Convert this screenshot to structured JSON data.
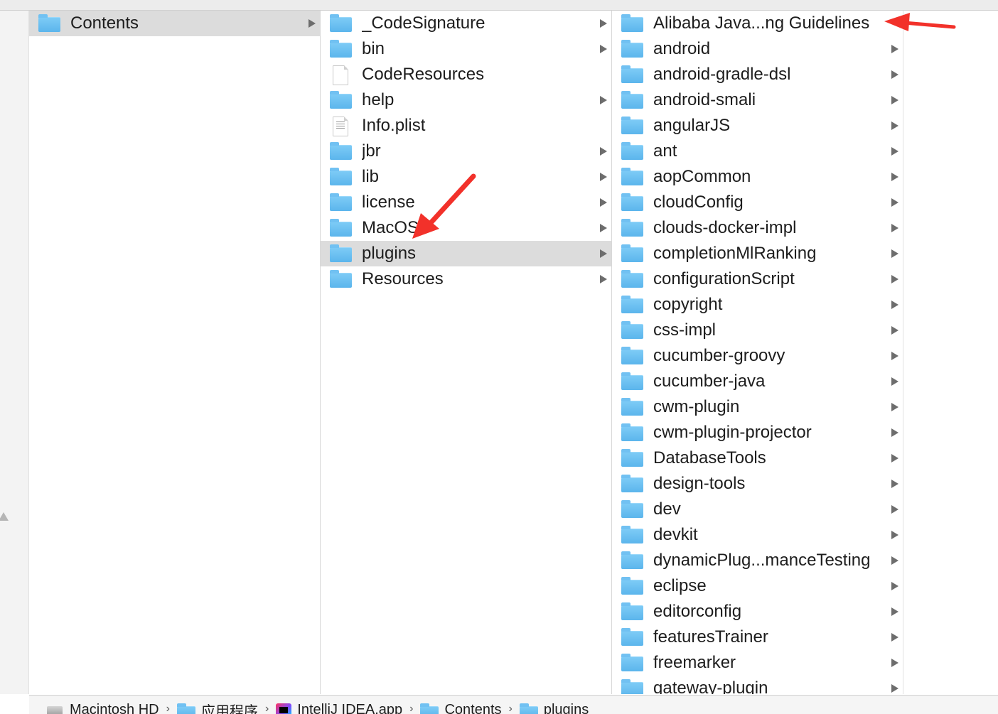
{
  "finder": {
    "columns": [
      {
        "items": [
          {
            "label": "Contents",
            "type": "folder",
            "has_children": true,
            "selected": true
          }
        ]
      },
      {
        "items": [
          {
            "label": "_CodeSignature",
            "type": "folder",
            "has_children": true
          },
          {
            "label": "bin",
            "type": "folder",
            "has_children": true
          },
          {
            "label": "CodeResources",
            "type": "file",
            "has_children": false
          },
          {
            "label": "help",
            "type": "folder",
            "has_children": true
          },
          {
            "label": "Info.plist",
            "type": "plist",
            "has_children": false
          },
          {
            "label": "jbr",
            "type": "folder",
            "has_children": true
          },
          {
            "label": "lib",
            "type": "folder",
            "has_children": true
          },
          {
            "label": "license",
            "type": "folder",
            "has_children": true
          },
          {
            "label": "MacOS",
            "type": "folder",
            "has_children": true
          },
          {
            "label": "plugins",
            "type": "folder",
            "has_children": true,
            "selected": true
          },
          {
            "label": "Resources",
            "type": "folder",
            "has_children": true
          }
        ]
      },
      {
        "items": [
          {
            "label": "Alibaba Java...ng Guidelines",
            "type": "folder",
            "has_children": false
          },
          {
            "label": "android",
            "type": "folder",
            "has_children": true
          },
          {
            "label": "android-gradle-dsl",
            "type": "folder",
            "has_children": true
          },
          {
            "label": "android-smali",
            "type": "folder",
            "has_children": true
          },
          {
            "label": "angularJS",
            "type": "folder",
            "has_children": true
          },
          {
            "label": "ant",
            "type": "folder",
            "has_children": true
          },
          {
            "label": "aopCommon",
            "type": "folder",
            "has_children": true
          },
          {
            "label": "cloudConfig",
            "type": "folder",
            "has_children": true
          },
          {
            "label": "clouds-docker-impl",
            "type": "folder",
            "has_children": true
          },
          {
            "label": "completionMlRanking",
            "type": "folder",
            "has_children": true
          },
          {
            "label": "configurationScript",
            "type": "folder",
            "has_children": true
          },
          {
            "label": "copyright",
            "type": "folder",
            "has_children": true
          },
          {
            "label": "css-impl",
            "type": "folder",
            "has_children": true
          },
          {
            "label": "cucumber-groovy",
            "type": "folder",
            "has_children": true
          },
          {
            "label": "cucumber-java",
            "type": "folder",
            "has_children": true
          },
          {
            "label": "cwm-plugin",
            "type": "folder",
            "has_children": true
          },
          {
            "label": "cwm-plugin-projector",
            "type": "folder",
            "has_children": true
          },
          {
            "label": "DatabaseTools",
            "type": "folder",
            "has_children": true
          },
          {
            "label": "design-tools",
            "type": "folder",
            "has_children": true
          },
          {
            "label": "dev",
            "type": "folder",
            "has_children": true
          },
          {
            "label": "devkit",
            "type": "folder",
            "has_children": true
          },
          {
            "label": "dynamicPlug...manceTesting",
            "type": "folder",
            "has_children": true
          },
          {
            "label": "eclipse",
            "type": "folder",
            "has_children": true
          },
          {
            "label": "editorconfig",
            "type": "folder",
            "has_children": true
          },
          {
            "label": "featuresTrainer",
            "type": "folder",
            "has_children": true
          },
          {
            "label": "freemarker",
            "type": "folder",
            "has_children": true
          },
          {
            "label": "gateway-plugin",
            "type": "folder",
            "has_children": true
          }
        ]
      }
    ]
  },
  "pathbar": [
    {
      "label": "Macintosh HD",
      "icon": "hard-drive-icon"
    },
    {
      "label": "应用程序",
      "icon": "folder-icon"
    },
    {
      "label": "IntelliJ IDEA.app",
      "icon": "intellij-app-icon"
    },
    {
      "label": "Contents",
      "icon": "folder-icon"
    },
    {
      "label": "plugins",
      "icon": "folder-icon"
    }
  ],
  "colors": {
    "selection": "#dcdcdc",
    "folder": "#6cc0f4",
    "annotation_arrow": "#f2312a"
  }
}
